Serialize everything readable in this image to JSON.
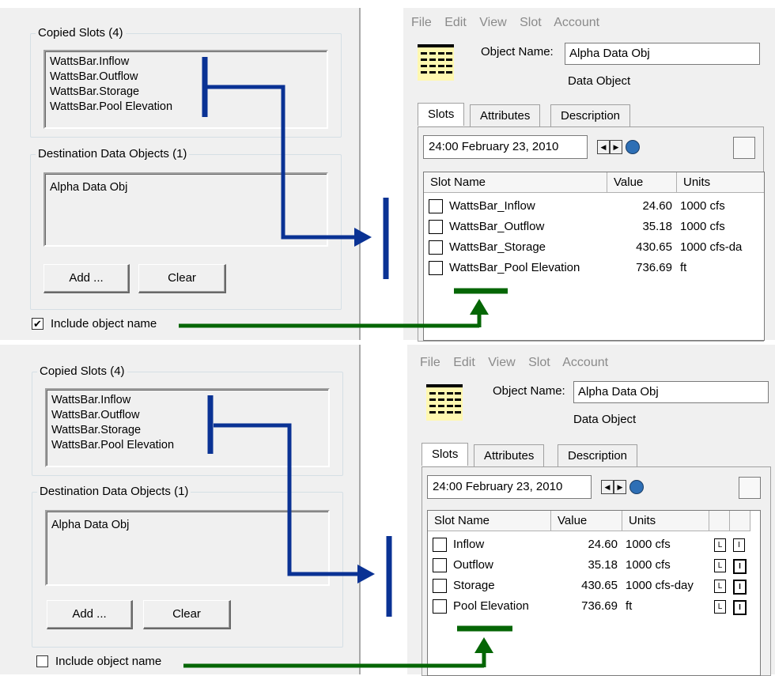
{
  "top": {
    "left": {
      "copied_title": "Copied Slots (4)",
      "copied_slots": [
        "WattsBar.Inflow",
        "WattsBar.Outflow",
        "WattsBar.Storage",
        "WattsBar.Pool Elevation"
      ],
      "dest_title": "Destination Data Objects (1)",
      "dest_objects": [
        "Alpha Data Obj"
      ],
      "add_label": "Add ...",
      "clear_label": "Clear",
      "checkbox_label": "Include object name",
      "checkbox_checked": "✔"
    },
    "right": {
      "menu": [
        "File",
        "Edit",
        "View",
        "Slot",
        "Account"
      ],
      "object_name_label": "Object Name:",
      "object_name_value": "Alpha Data Obj",
      "object_type": "Data Object",
      "tabs": [
        "Slots",
        "Attributes",
        "Description"
      ],
      "date": "24:00 February 23, 2010",
      "headers": [
        "Slot Name",
        "Value",
        "Units"
      ],
      "rows": [
        {
          "name": "WattsBar_Inflow",
          "value": "24.60",
          "units": "1000 cfs"
        },
        {
          "name": "WattsBar_Outflow",
          "value": "35.18",
          "units": "1000 cfs"
        },
        {
          "name": "WattsBar_Storage",
          "value": "430.65",
          "units": "1000 cfs-da"
        },
        {
          "name": "WattsBar_Pool Elevation",
          "value": "736.69",
          "units": "ft"
        }
      ]
    }
  },
  "bottom": {
    "left": {
      "copied_title": "Copied Slots (4)",
      "copied_slots": [
        "WattsBar.Inflow",
        "WattsBar.Outflow",
        "WattsBar.Storage",
        "WattsBar.Pool Elevation"
      ],
      "dest_title": "Destination Data Objects (1)",
      "dest_objects": [
        "Alpha Data Obj"
      ],
      "add_label": "Add ...",
      "clear_label": "Clear",
      "checkbox_label": "Include object name",
      "checkbox_checked": ""
    },
    "right": {
      "menu": [
        "File",
        "Edit",
        "View",
        "Slot",
        "Account"
      ],
      "object_name_label": "Object Name:",
      "object_name_value": "Alpha Data Obj",
      "object_type": "Data Object",
      "tabs": [
        "Slots",
        "Attributes",
        "Description"
      ],
      "date": "24:00 February 23, 2010",
      "headers": [
        "Slot Name",
        "Value",
        "Units"
      ],
      "rows": [
        {
          "name": "Inflow",
          "value": "24.60",
          "units": "1000 cfs"
        },
        {
          "name": "Outflow",
          "value": "35.18",
          "units": "1000 cfs"
        },
        {
          "name": "Storage",
          "value": "430.65",
          "units": "1000 cfs-day"
        },
        {
          "name": "Pool Elevation",
          "value": "736.69",
          "units": "ft"
        }
      ],
      "flag_l": "L",
      "flag_i": "I"
    }
  },
  "colors": {
    "blue_arrow": "#0a3294",
    "green_arrow": "#056605"
  }
}
